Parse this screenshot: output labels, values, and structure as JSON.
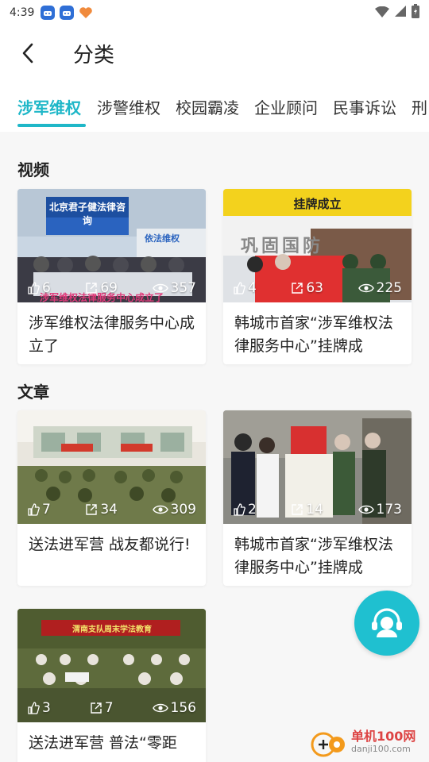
{
  "status_bar": {
    "time": "4:39"
  },
  "header": {
    "title": "分类"
  },
  "tabs": [
    {
      "label": "涉军维权",
      "active": true
    },
    {
      "label": "涉警维权",
      "active": false
    },
    {
      "label": "校园霸凌",
      "active": false
    },
    {
      "label": "企业顾问",
      "active": false
    },
    {
      "label": "民事诉讼",
      "active": false
    },
    {
      "label": "刑",
      "active": false
    }
  ],
  "sections": {
    "videos": {
      "title": "视频",
      "items": [
        {
          "title": "涉军维权法律服务中心成立了",
          "likes": "6",
          "shares": "69",
          "views": "357",
          "image_banner": "北京君子健法律咨询",
          "image_caption": "涉军维权法律服务中心成立了",
          "image_sign": "依法维权"
        },
        {
          "title": "韩城市首家“涉军维权法律服务中心”挂牌成",
          "likes": "4",
          "shares": "63",
          "views": "225",
          "image_banner": "挂牌成立",
          "image_sign": "巩固国防"
        }
      ]
    },
    "articles": {
      "title": "文章",
      "items": [
        {
          "title": "送法进军营 战友都说行!",
          "likes": "7",
          "shares": "34",
          "views": "309"
        },
        {
          "title": "韩城市首家“涉军维权法律服务中心”挂牌成",
          "likes": "2",
          "shares": "14",
          "views": "173"
        },
        {
          "title": "送法进军营 普法“零距",
          "likes": "3",
          "shares": "7",
          "views": "156",
          "image_banner": "渭南支队周末学法教育"
        }
      ]
    }
  },
  "watermark": {
    "cn": "单机100网",
    "en": "danji100.com"
  },
  "colors": {
    "accent": "#1fb7c8",
    "fab": "#1fc0d0"
  }
}
